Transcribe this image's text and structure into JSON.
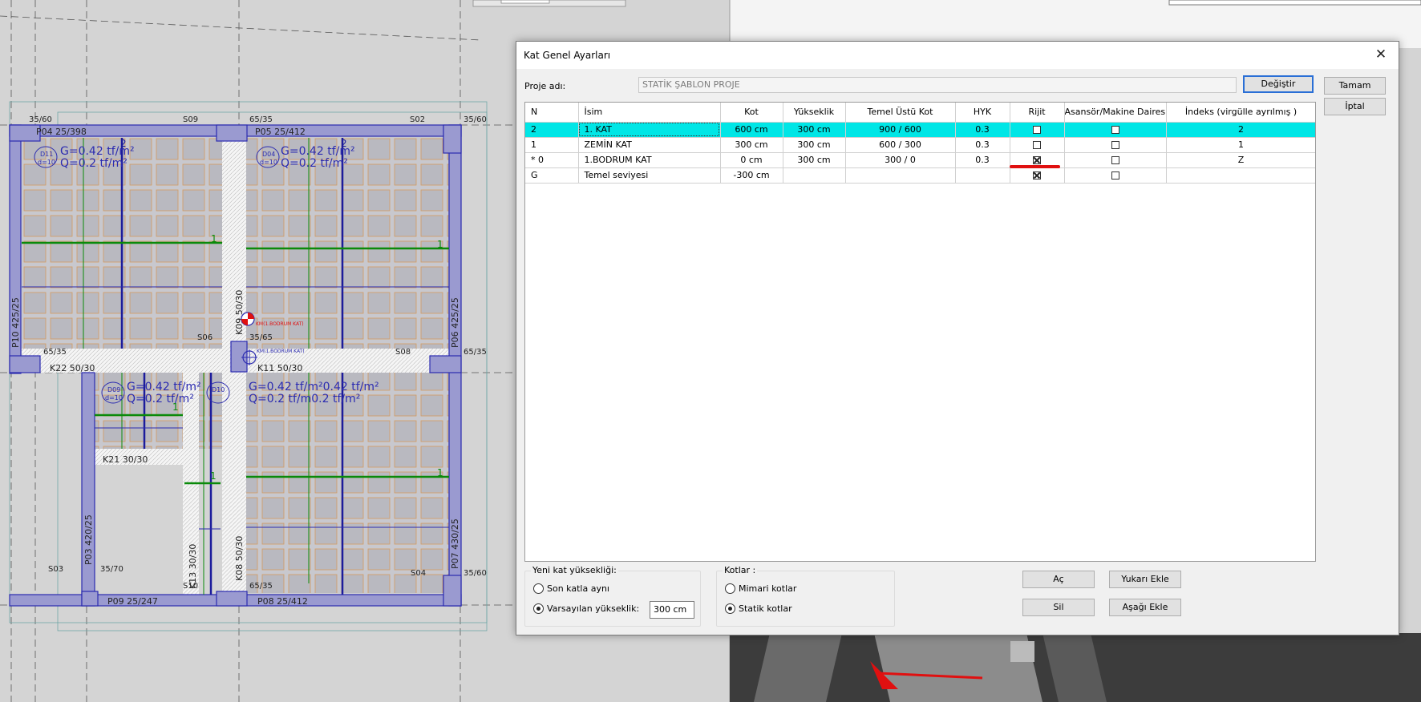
{
  "dialog": {
    "title": "Kat Genel Ayarları",
    "close_glyph": "✕",
    "project_label": "Proje adı:",
    "project_value": "STATİK ŞABLON PROJE",
    "change_button": "Değiştir",
    "ok_button": "Tamam",
    "cancel_button": "İptal"
  },
  "table": {
    "headers": [
      "N",
      "İsim",
      "Kot",
      "Yükseklik",
      "Temel Üstü Kot",
      "HYK",
      "Rijit",
      "Asansör/Makine Dairesi",
      "İndeks (virgülle ayrılmış )"
    ],
    "rows": [
      {
        "n": "2",
        "name": "1. KAT",
        "kot": "600 cm",
        "height": "300 cm",
        "temel": "900 / 600",
        "hyk": "0.3",
        "rigid": false,
        "elevator": false,
        "index": "2",
        "selected": true
      },
      {
        "n": "1",
        "name": "ZEMİN  KAT",
        "kot": "300 cm",
        "height": "300 cm",
        "temel": "600 / 300",
        "hyk": "0.3",
        "rigid": false,
        "elevator": false,
        "index": "1",
        "selected": false
      },
      {
        "n": "* 0",
        "name": "1.BODRUM KAT",
        "kot": "0 cm",
        "height": "300 cm",
        "temel": "300 / 0",
        "hyk": "0.3",
        "rigid": true,
        "elevator": false,
        "index": "Z",
        "selected": false
      },
      {
        "n": "G",
        "name": "Temel seviyesi",
        "kot": "-300 cm",
        "height": "",
        "temel": "",
        "hyk": "",
        "rigid": true,
        "elevator": false,
        "index": "",
        "selected": false
      }
    ]
  },
  "new_height": {
    "group_title": "Yeni kat yüksekliği:",
    "same_as_last": "Son katla aynı",
    "default_height": "Varsayılan yükseklik:",
    "default_value": "300 cm",
    "selected": "default"
  },
  "levels": {
    "group_title": "Kotlar :",
    "architectural": "Mimari kotlar",
    "structural": "Statik kotlar",
    "selected": "structural"
  },
  "actions": {
    "open": "Aç",
    "insert_above": "Yukarı Ekle",
    "delete": "Sil",
    "insert_below": "Aşağı Ekle"
  },
  "plan": {
    "beams": [
      "K22 50/30",
      "K11 50/30",
      "K21 30/30",
      "K09 50/30",
      "K08 50/30",
      "K13 30/30"
    ],
    "columns": [
      "P04 25/398",
      "P05 25/412",
      "P10 425/25",
      "P06 425/25",
      "P03 420/25",
      "P07 430/25",
      "P09 25/247",
      "P08 25/412"
    ],
    "column_dims": [
      "35/60",
      "65/35",
      "35/60",
      "65/35",
      "35/65",
      "65/35",
      "35/70",
      "65/35",
      "35/60"
    ],
    "spaces": [
      "S09",
      "S02",
      "S06",
      "S08",
      "S03",
      "S04",
      "S10"
    ],
    "slab_tags": [
      "D11",
      "D04",
      "D09",
      "D10",
      "D10"
    ],
    "slab_thickness": "d=10",
    "load_g": "G=0.42 tf/m²",
    "load_q": "Q=0.2 tf/m²",
    "load_mixed_g": "G=0.42 tf/m²0.42 tf/m²",
    "load_mixed_q": "Q=0.2 tf/m0.2 tf/m²",
    "level_marker": "KM(1.BODRUM KAT)",
    "strip_numbers": [
      "1",
      "2"
    ]
  },
  "colors": {
    "selection": "#00e6e6",
    "accent_button": "#2a6fd6",
    "plan_blue": "#2b2bb0",
    "plan_green": "#0a8a0a",
    "plan_orange": "#d4a064",
    "marker_red": "#e01010"
  }
}
